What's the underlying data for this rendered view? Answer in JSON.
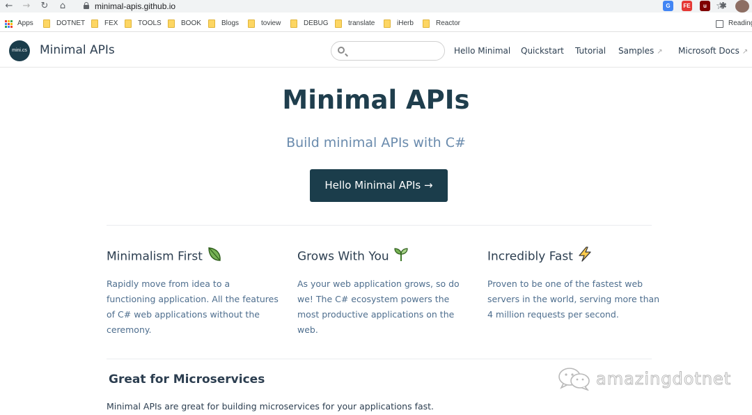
{
  "browser": {
    "url": "minimal-apis.github.io",
    "bookmarks": [
      "Apps",
      "DOTNET",
      "FEX",
      "TOOLS",
      "BOOK",
      "Blogs",
      "toview",
      "DEBUG",
      "translate",
      "iHerb",
      "Reactor"
    ],
    "reading_list": "Reading"
  },
  "header": {
    "logo_text": "mini.cs",
    "brand": "Minimal APIs",
    "search_placeholder": "",
    "nav": [
      {
        "label": "Hello Minimal",
        "external": false
      },
      {
        "label": "Quickstart",
        "external": false
      },
      {
        "label": "Tutorial",
        "external": false
      },
      {
        "label": "Samples",
        "external": true
      },
      {
        "label": "Microsoft Docs",
        "external": true
      }
    ]
  },
  "hero": {
    "title": "Minimal APIs",
    "tagline": "Build minimal APIs with C#",
    "cta": "Hello Minimal APIs →"
  },
  "features": [
    {
      "title": "Minimalism First",
      "icon": "leaf-icon",
      "text": "Rapidly move from idea to a functioning application. All the features of C# web applications without the ceremony."
    },
    {
      "title": "Grows With You",
      "icon": "seedling-icon",
      "text": "As your web application grows, so do we! The C# ecosystem powers the most productive applications on the web."
    },
    {
      "title": "Incredibly Fast",
      "icon": "lightning-icon",
      "text": "Proven to be one of the fastest web servers in the world, serving more than 4 million requests per second."
    }
  ],
  "section": {
    "title": "Great for Microservices",
    "text": "Minimal APIs are great for building microservices for your applications fast."
  },
  "watermark": "amazingdotnet",
  "colors": {
    "brand_dark": "#1b3d4b",
    "tagline": "#6a8bad",
    "body_text": "#4e6e8e"
  }
}
